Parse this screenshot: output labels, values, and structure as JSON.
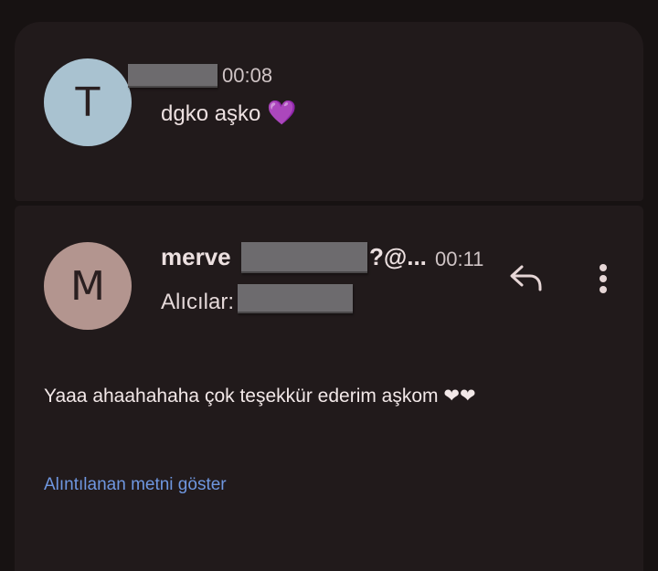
{
  "messages": [
    {
      "avatar_letter": "T",
      "time": "00:08",
      "preview": "dgko aşko",
      "preview_emoji": "💜"
    },
    {
      "avatar_letter": "M",
      "sender_prefix": "merve",
      "sender_suffix": "?@...",
      "time": "00:11",
      "recipients_label": "Alıcılar:",
      "body": "Yaaa ahaahahaha çok teşekkür ederim aşkom ❤❤",
      "show_quoted_label": "Alıntılanan metni göster"
    }
  ],
  "icons": {
    "reply": "reply-icon",
    "more": "more-vert-icon",
    "purple_heart": "purple-heart-emoji"
  },
  "colors": {
    "background": "#171212",
    "card": "#211a1b",
    "avatar_t": "#a9c2d0",
    "avatar_m": "#b3958f",
    "link": "#6f97e0",
    "redaction": "#6d6b6e"
  }
}
